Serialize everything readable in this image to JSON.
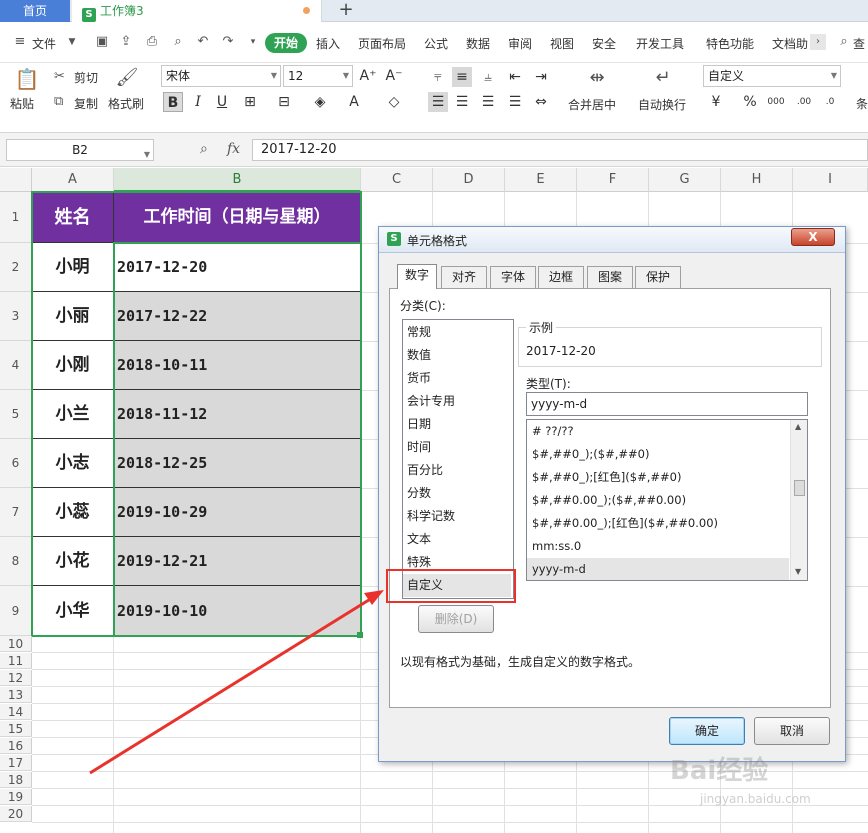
{
  "tabs": {
    "home": "首页",
    "workbook": "工作簿3"
  },
  "menu": {
    "file": "文件",
    "items": [
      "开始",
      "插入",
      "页面布局",
      "公式",
      "数据",
      "审阅",
      "视图",
      "安全",
      "开发工具",
      "特色功能",
      "文档助"
    ],
    "search_label": "查"
  },
  "ribbon": {
    "paste": "粘贴",
    "cut": "剪切",
    "copy": "复制",
    "format_painter": "格式刷",
    "font_name": "宋体",
    "font_size": "12",
    "merge_center": "合并居中",
    "wrap_text": "自动换行",
    "number_format": "自定义",
    "more": "条"
  },
  "formula_bar": {
    "cell_ref": "B2",
    "fx": "fx",
    "value": "2017-12-20"
  },
  "sheet": {
    "columns": [
      "A",
      "B",
      "C",
      "D",
      "E",
      "F",
      "G",
      "H",
      "I"
    ],
    "header_name": "姓名",
    "header_time": "工作时间（日期与星期）",
    "rows": [
      {
        "num": "2",
        "name": "小明",
        "date": "2017-12-20"
      },
      {
        "num": "3",
        "name": "小丽",
        "date": "2017-12-22"
      },
      {
        "num": "4",
        "name": "小刚",
        "date": "2018-10-11"
      },
      {
        "num": "5",
        "name": "小兰",
        "date": "2018-11-12"
      },
      {
        "num": "6",
        "name": "小志",
        "date": "2018-12-25"
      },
      {
        "num": "7",
        "name": "小蕊",
        "date": "2019-10-29"
      },
      {
        "num": "8",
        "name": "小花",
        "date": "2019-12-21"
      },
      {
        "num": "9",
        "name": "小华",
        "date": "2019-10-10"
      }
    ],
    "row_numbers": [
      "1",
      "10",
      "11",
      "12",
      "13",
      "14",
      "15",
      "16",
      "17",
      "18",
      "19",
      "20"
    ]
  },
  "dialog": {
    "title": "单元格格式",
    "close": "X",
    "tabs": [
      "数字",
      "对齐",
      "字体",
      "边框",
      "图案",
      "保护"
    ],
    "category_label": "分类(C):",
    "categories": [
      "常规",
      "数值",
      "货币",
      "会计专用",
      "日期",
      "时间",
      "百分比",
      "分数",
      "科学记数",
      "文本",
      "特殊",
      "自定义"
    ],
    "sample_label": "示例",
    "sample_value": "2017-12-20",
    "type_label": "类型(T):",
    "type_value": "yyyy-m-d",
    "types": [
      "# ??/??",
      "$#,##0_);($#,##0)",
      "$#,##0_);[红色]($#,##0)",
      "$#,##0.00_);($#,##0.00)",
      "$#,##0.00_);[红色]($#,##0.00)",
      "mm:ss.0",
      "yyyy-m-d"
    ],
    "delete": "删除(D)",
    "description": "以现有格式为基础，生成自定义的数字格式。",
    "ok": "确定",
    "cancel": "取消"
  },
  "watermark": {
    "brand": "Bai经验",
    "url": "jingyan.baidu.com"
  },
  "colors": {
    "accent_green": "#2fa353",
    "header_purple": "#7030a0",
    "highlight_red": "#e8322b"
  }
}
